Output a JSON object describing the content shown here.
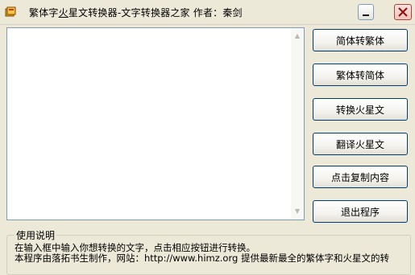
{
  "window": {
    "title_pre": "繁体字",
    "title_underlined": "火",
    "title_post": "星文转换器-文字转换器之家  作者：秦剑"
  },
  "editor": {
    "value": "",
    "placeholder": ""
  },
  "buttons": [
    "简体转繁体",
    "繁体转简体",
    "转换火星文",
    "翻译火星文",
    "点击复制内容",
    "退出程序"
  ],
  "usage": {
    "title": "使用说明",
    "line1": "在输入框中输入你想转换的文字，点击相应按钮进行转换。",
    "line2": "本程序由落拓书生制作，网站：http://www.himz.org 提供最新最全的繁体字和火星文的转"
  },
  "colors": {
    "face": "#ece9d8",
    "border": "#003c74",
    "close": "#b04038"
  },
  "icons": [
    "app-icon",
    "minimize-icon",
    "close-icon",
    "scroll-up-icon",
    "scroll-down-icon"
  ]
}
